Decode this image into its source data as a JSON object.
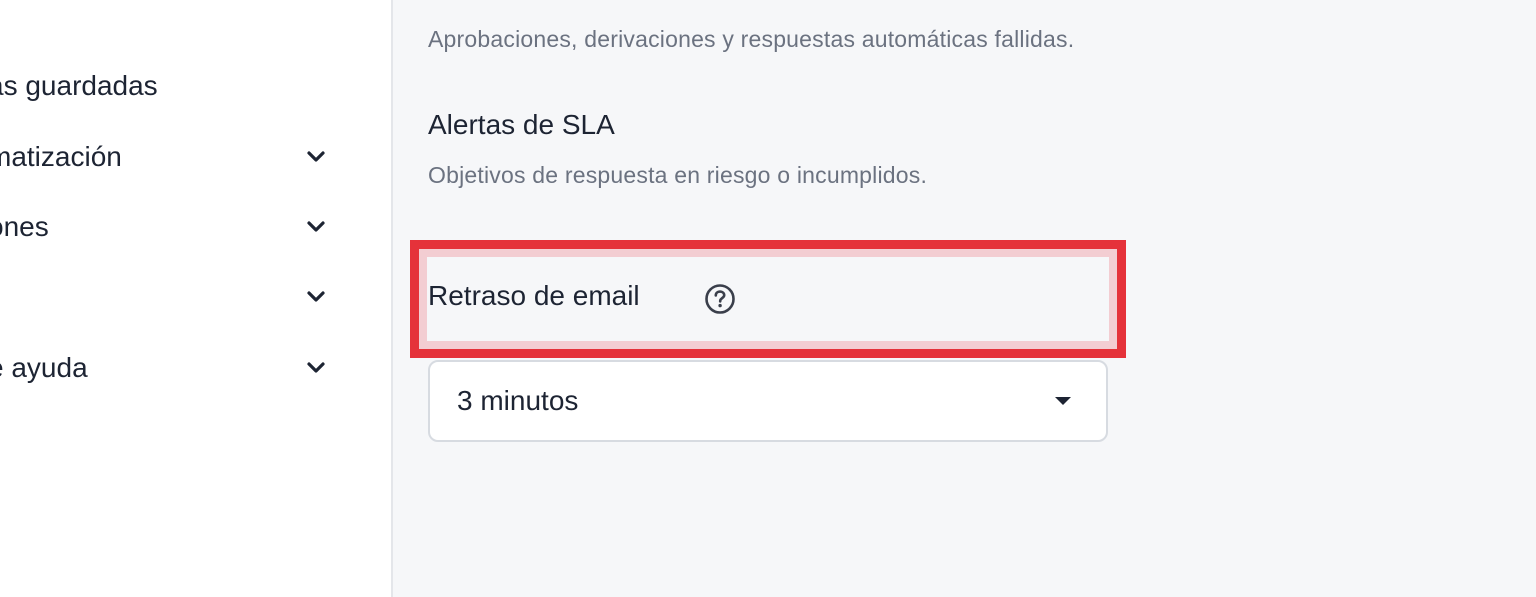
{
  "sidebar": {
    "items": [
      {
        "label": "as guardadas",
        "has_chevron": false
      },
      {
        "label": "matización",
        "has_chevron": true,
        "icon": "chevron-down-icon"
      },
      {
        "label": "ones",
        "has_chevron": true,
        "icon": "chevron-down-icon"
      },
      {
        "label": "",
        "has_chevron": true,
        "icon": "chevron-down-icon"
      },
      {
        "label": "e ayuda",
        "has_chevron": true,
        "icon": "chevron-down-icon"
      }
    ]
  },
  "main": {
    "top_description": "Aprobaciones, derivaciones y respuestas automáticas fallidas.",
    "sla": {
      "title": "Alertas de SLA",
      "description": "Objetivos de respuesta en riesgo o incumplidos."
    },
    "email_delay": {
      "label": "Retraso de email",
      "help_icon": "question-circle-icon",
      "selected_value": "3 minutos",
      "dropdown_icon": "caret-down-icon"
    }
  },
  "colors": {
    "sidebar_bg": "#ffffff",
    "main_bg": "#f6f7f9",
    "text_primary": "#1d2433",
    "text_secondary": "#6b7280",
    "highlight_border": "#e5323a",
    "highlight_glow": "#f3cdd2",
    "select_border": "#d7dbe1"
  }
}
